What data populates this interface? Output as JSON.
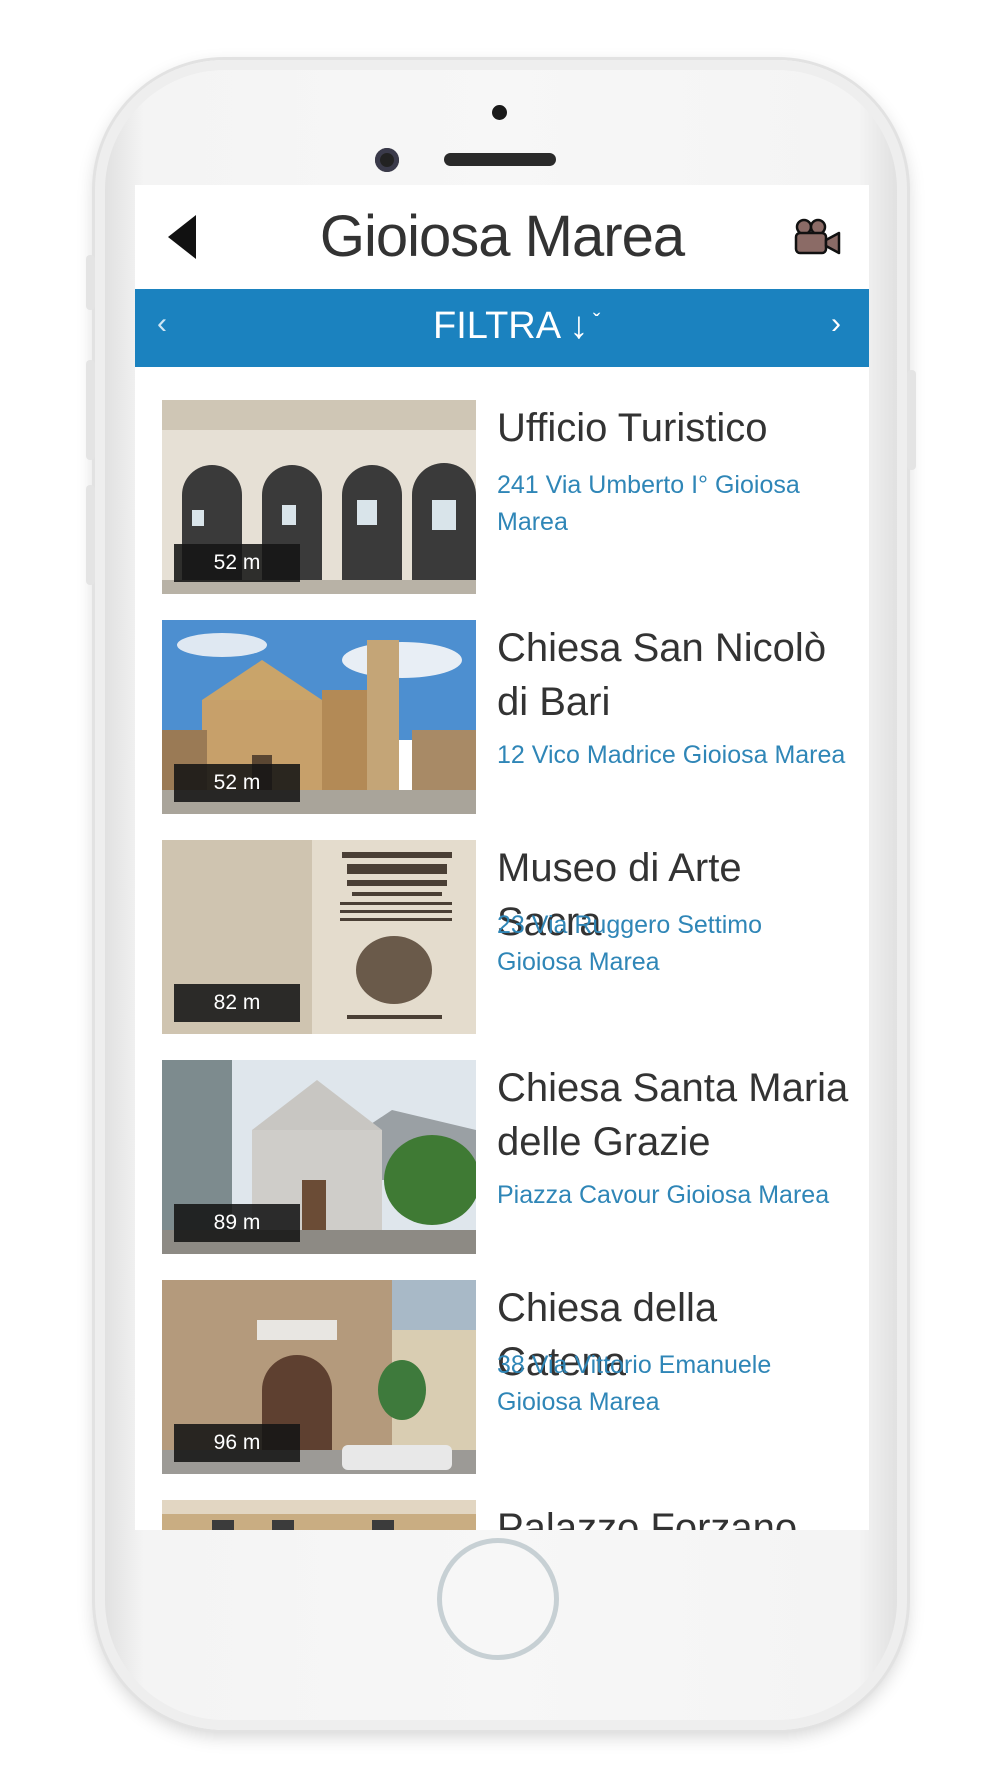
{
  "header": {
    "title": "Gioiosa Marea",
    "back_icon": "back-arrow-icon",
    "video_icon": "video-camera-icon"
  },
  "filter_bar": {
    "prev": "‹",
    "label": "FILTRA ↓",
    "caret": "ˇ",
    "next": "›",
    "color": "#1b82bf"
  },
  "places": [
    {
      "name": "Ufficio Turistico",
      "address": "241 Via Umberto I° Gioiosa Marea",
      "distance": "52 m"
    },
    {
      "name": "Chiesa San Nicolò di Bari",
      "address": "12 Vico Madrice Gioiosa Marea",
      "distance": "52 m"
    },
    {
      "name": "Museo di Arte Sacra",
      "address": "23 Via Ruggero Settimo Gioiosa Marea",
      "distance": "82 m"
    },
    {
      "name": "Chiesa Santa Maria delle Grazie",
      "address": "Piazza Cavour Gioiosa Marea",
      "distance": "89 m"
    },
    {
      "name": "Chiesa della Catena",
      "address": "38 Via Vittorio Emanuele Gioiosa Marea",
      "distance": "96 m"
    },
    {
      "name": "Palazzo Forzano",
      "address": "",
      "distance": ""
    }
  ]
}
